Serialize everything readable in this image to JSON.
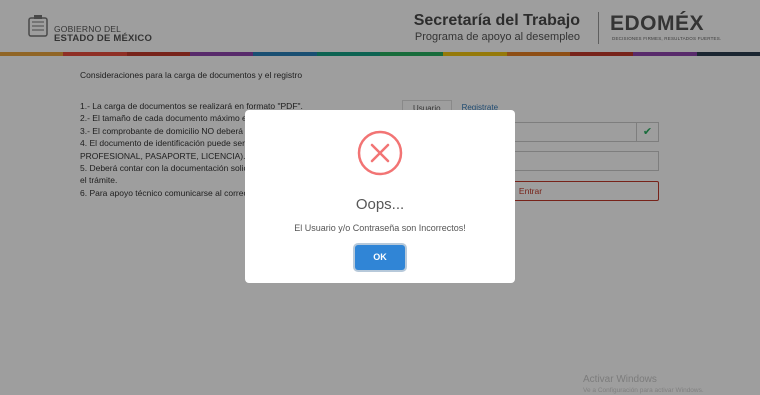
{
  "header": {
    "gov_line1": "GOBIERNO DEL",
    "gov_line2": "ESTADO DE MÉXICO",
    "secretaria_title": "Secretaría del Trabajo",
    "secretaria_subtitle": "Programa de apoyo al desempleo",
    "edomex_logo": "EDOMÉX",
    "edomex_tagline": "DECISIONES FIRMES, RESULTADOS FUERTES."
  },
  "band_colors": [
    "#e8a33c",
    "#e74c3c",
    "#c0392b",
    "#8e44ad",
    "#2980b9",
    "#16a085",
    "#27ae60",
    "#f1c40f",
    "#e67e22",
    "#c0392b",
    "#8e44ad",
    "#2c3e50"
  ],
  "main": {
    "considerations_title": "Consideraciones para la carga de documentos y el registro",
    "rules": [
      "1.- La carga de documentos se realizará en formato \"PDF\".",
      "2.- El tamaño de cada documento máximo e",
      "3.- El comprobante de domicilio NO deberá",
      "4. El documento de identificación puede ser.",
      "PROFESIONAL, PASAPORTE, LICENCIA).",
      "5. Deberá contar con la documentación solic",
      "el trámite.",
      "6. Para apoyo técnico comunicarse al correo"
    ],
    "tabs": [
      {
        "label": "Usuario"
      },
      {
        "label": "Registrate"
      }
    ],
    "enter_button_label": "Entrar",
    "watermark_line1": "Activar Windows",
    "watermark_line2": "Ve a Configuración para activar Windows."
  },
  "modal": {
    "icon": "error-x-circle-icon",
    "title": "Oops...",
    "message": "El Usuario y/o Contraseña son Incorrectos!",
    "ok_label": "OK",
    "accent_color": "#f27474",
    "button_color": "#3085d6"
  }
}
